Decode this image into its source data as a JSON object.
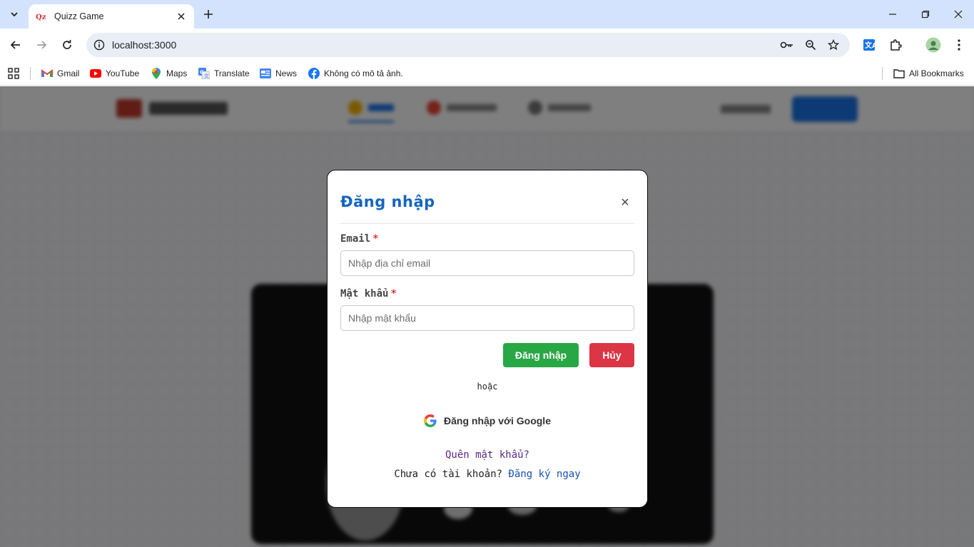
{
  "browser": {
    "tab_title": "Quizz Game",
    "url": "localhost:3000",
    "bookmarks": [
      {
        "label": "Gmail",
        "icon": "gmail-icon"
      },
      {
        "label": "YouTube",
        "icon": "youtube-icon"
      },
      {
        "label": "Maps",
        "icon": "maps-icon"
      },
      {
        "label": "Translate",
        "icon": "translate-icon"
      },
      {
        "label": "News",
        "icon": "news-icon"
      },
      {
        "label": "Không có mô tả ảnh.",
        "icon": "facebook-icon"
      }
    ],
    "all_bookmarks_label": "All Bookmarks"
  },
  "modal": {
    "title": "Đăng nhập",
    "close_symbol": "×",
    "email_label": "Email",
    "email_placeholder": "Nhập địa chỉ email",
    "password_label": "Mật khẩu",
    "password_placeholder": "Nhập mật khẩu",
    "required_mark": "*",
    "login_button": "Đăng nhập",
    "cancel_button": "Hủy",
    "or_text": "hoặc",
    "google_button": "Đăng nhập với Google",
    "forgot_password": "Quên mật khẩu?",
    "no_account_text": "Chưa có tài khoản?",
    "signup_link": "Đăng ký ngay"
  },
  "colors": {
    "title": "#1565c0",
    "login_button": "#28a745",
    "cancel_button": "#dc3545",
    "tabbar": "#d3e3fd",
    "overlay": "rgba(0,0,0,0.5)"
  }
}
